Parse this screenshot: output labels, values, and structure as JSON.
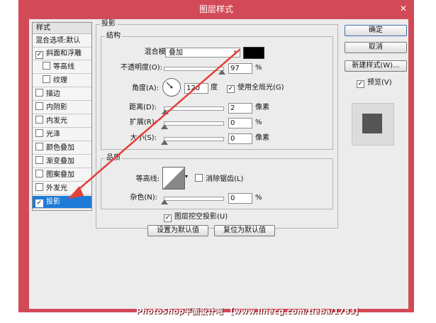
{
  "window": {
    "title": "图层样式",
    "close_glyph": "✕"
  },
  "left_panel": {
    "header": "样式",
    "items": [
      {
        "label": "混合选项:默认",
        "checkbox": false,
        "checked": false,
        "selected": false
      },
      {
        "label": "斜面和浮雕",
        "checkbox": true,
        "checked": true,
        "selected": false
      },
      {
        "label": "等高线",
        "checkbox": true,
        "checked": false,
        "selected": false,
        "indent": true
      },
      {
        "label": "纹理",
        "checkbox": true,
        "checked": false,
        "selected": false,
        "indent": true
      },
      {
        "label": "描边",
        "checkbox": true,
        "checked": false,
        "selected": false
      },
      {
        "label": "内阴影",
        "checkbox": true,
        "checked": false,
        "selected": false
      },
      {
        "label": "内发光",
        "checkbox": true,
        "checked": false,
        "selected": false
      },
      {
        "label": "光泽",
        "checkbox": true,
        "checked": false,
        "selected": false
      },
      {
        "label": "颜色叠加",
        "checkbox": true,
        "checked": false,
        "selected": false
      },
      {
        "label": "渐变叠加",
        "checkbox": true,
        "checked": false,
        "selected": false
      },
      {
        "label": "图案叠加",
        "checkbox": true,
        "checked": false,
        "selected": false
      },
      {
        "label": "外发光",
        "checkbox": true,
        "checked": false,
        "selected": false
      },
      {
        "label": "投影",
        "checkbox": true,
        "checked": true,
        "selected": true
      }
    ]
  },
  "drop_shadow": {
    "title": "投影",
    "structure": {
      "title": "结构",
      "blend_mode_label": "混合模式:",
      "blend_mode_value": "叠加",
      "blend_color": "#000000",
      "opacity_label": "不透明度(O):",
      "opacity_value": "97",
      "opacity_unit": "%",
      "opacity_fraction": 0.97,
      "angle_label": "角度(A):",
      "angle_value": "120",
      "angle_unit": "度",
      "global_light_label": "使用全局光(G)",
      "global_light_checked": true,
      "distance_label": "距离(D):",
      "distance_value": "2",
      "distance_unit": "像素",
      "spread_label": "扩展(R):",
      "spread_value": "0",
      "spread_unit": "%",
      "size_label": "大小(S):",
      "size_value": "0",
      "size_unit": "像素"
    },
    "quality": {
      "title": "品质",
      "contour_label": "等高线:",
      "antialias_label": "消除锯齿(L)",
      "antialias_checked": false,
      "noise_label": "杂色(N):",
      "noise_value": "0",
      "noise_unit": "%"
    },
    "knockout_label": "图层挖空投影(U)",
    "knockout_checked": true,
    "set_default_label": "设置为默认值",
    "reset_default_label": "复位为默认值"
  },
  "right_buttons": {
    "ok": "确定",
    "cancel": "取消",
    "new_style": "新建样式(W)...",
    "preview_label": "预览(V)",
    "preview_checked": true
  },
  "watermark": "PhotoShop平面设计吧 【www.linecg.com/tieba/1783】",
  "colors": {
    "frame": "#d24a57",
    "selection": "#1f7bd8",
    "arrow": "#e5403a"
  }
}
